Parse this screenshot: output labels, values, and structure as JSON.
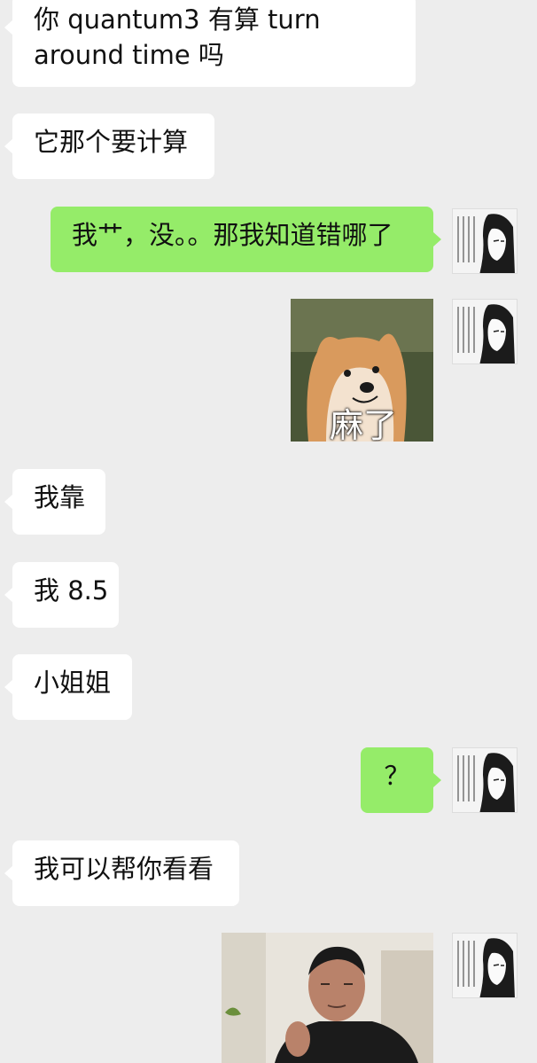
{
  "messages": [
    {
      "side": "left",
      "text": "你 quantum3 有算 turn around time 吗"
    },
    {
      "side": "left",
      "text": "它那个要计算"
    },
    {
      "side": "right",
      "text": "我艹，没。。那我知道错哪了"
    },
    {
      "side": "right",
      "sticker": "dog-meme",
      "caption": "麻了"
    },
    {
      "side": "left",
      "text": "我靠"
    },
    {
      "side": "left",
      "text": "我 8.5"
    },
    {
      "side": "left",
      "text": "小姐姐"
    },
    {
      "side": "right",
      "text": "？"
    },
    {
      "side": "left",
      "text": "我可以帮你看看"
    },
    {
      "side": "right",
      "sticker": "man-photo-meme"
    }
  ],
  "colors": {
    "background": "#ededed",
    "incoming_bubble": "#ffffff",
    "outgoing_bubble": "#95ec69"
  },
  "icons": {
    "self_avatar": "manga-girl-avatar-icon"
  }
}
